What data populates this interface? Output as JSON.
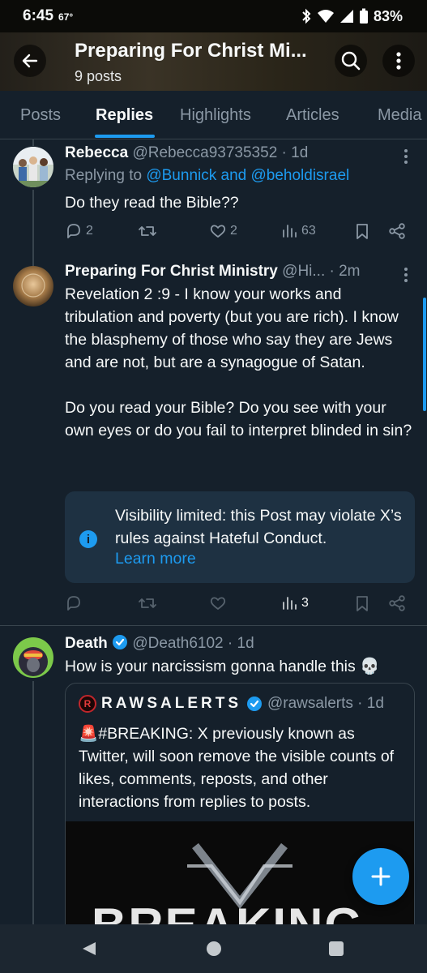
{
  "status_bar": {
    "time": "6:45",
    "temp": "67°",
    "battery": "83%"
  },
  "header": {
    "title": "Preparing For Christ Mi...",
    "subtitle": "9 posts"
  },
  "tabs": [
    {
      "label": "Posts",
      "active": false
    },
    {
      "label": "Replies",
      "active": true
    },
    {
      "label": "Highlights",
      "active": false
    },
    {
      "label": "Articles",
      "active": false
    },
    {
      "label": "Media",
      "active": false
    }
  ],
  "tweets": [
    {
      "name": "Rebecca",
      "meta": " @Rebecca93735352 · 1d",
      "replying_prefix": "Replying to ",
      "replying_to": "@Bunnick and @beholdisrael",
      "text": "Do they read the Bible??",
      "replies": "2",
      "reposts": "",
      "likes": "2",
      "views": "63"
    },
    {
      "name": "Preparing For Christ Ministry",
      "meta": " @Hi... · 2m",
      "text": "Revelation 2 :9 - I know your works and tribulation and poverty (but you are rich). I know the blasphemy of those who say they are Jews and are not, but are a synagogue of Satan.\n\nDo you read your Bible? Do you see with your own eyes or do you fail to interpret blinded in sin?",
      "notice_text": "Visibility limited: this Post may violate X’s rules against Hateful Conduct.",
      "notice_link": "Learn more",
      "views": "3"
    },
    {
      "name": "Death",
      "meta": " @Death6102 · 1d",
      "text": "How is your narcissism gonna handle this 💀",
      "quote": {
        "name": "RAWSALERTS",
        "meta": "@rawsalerts · 1d",
        "text": "🚨#BREAKING: X previously known as Twitter, will soon remove the visible counts of likes, comments, reposts, and other interactions from replies to posts.",
        "media_text": "BREAKING"
      }
    }
  ],
  "colors": {
    "background": "#15202b",
    "accent": "#1d9bf0",
    "muted": "#8b98a5"
  },
  "icons": [
    "back-arrow-icon",
    "search-icon",
    "more-vertical-icon",
    "reply-icon",
    "repost-icon",
    "like-icon",
    "views-icon",
    "bookmark-icon",
    "share-icon",
    "info-icon",
    "verified-icon",
    "plus-icon"
  ]
}
